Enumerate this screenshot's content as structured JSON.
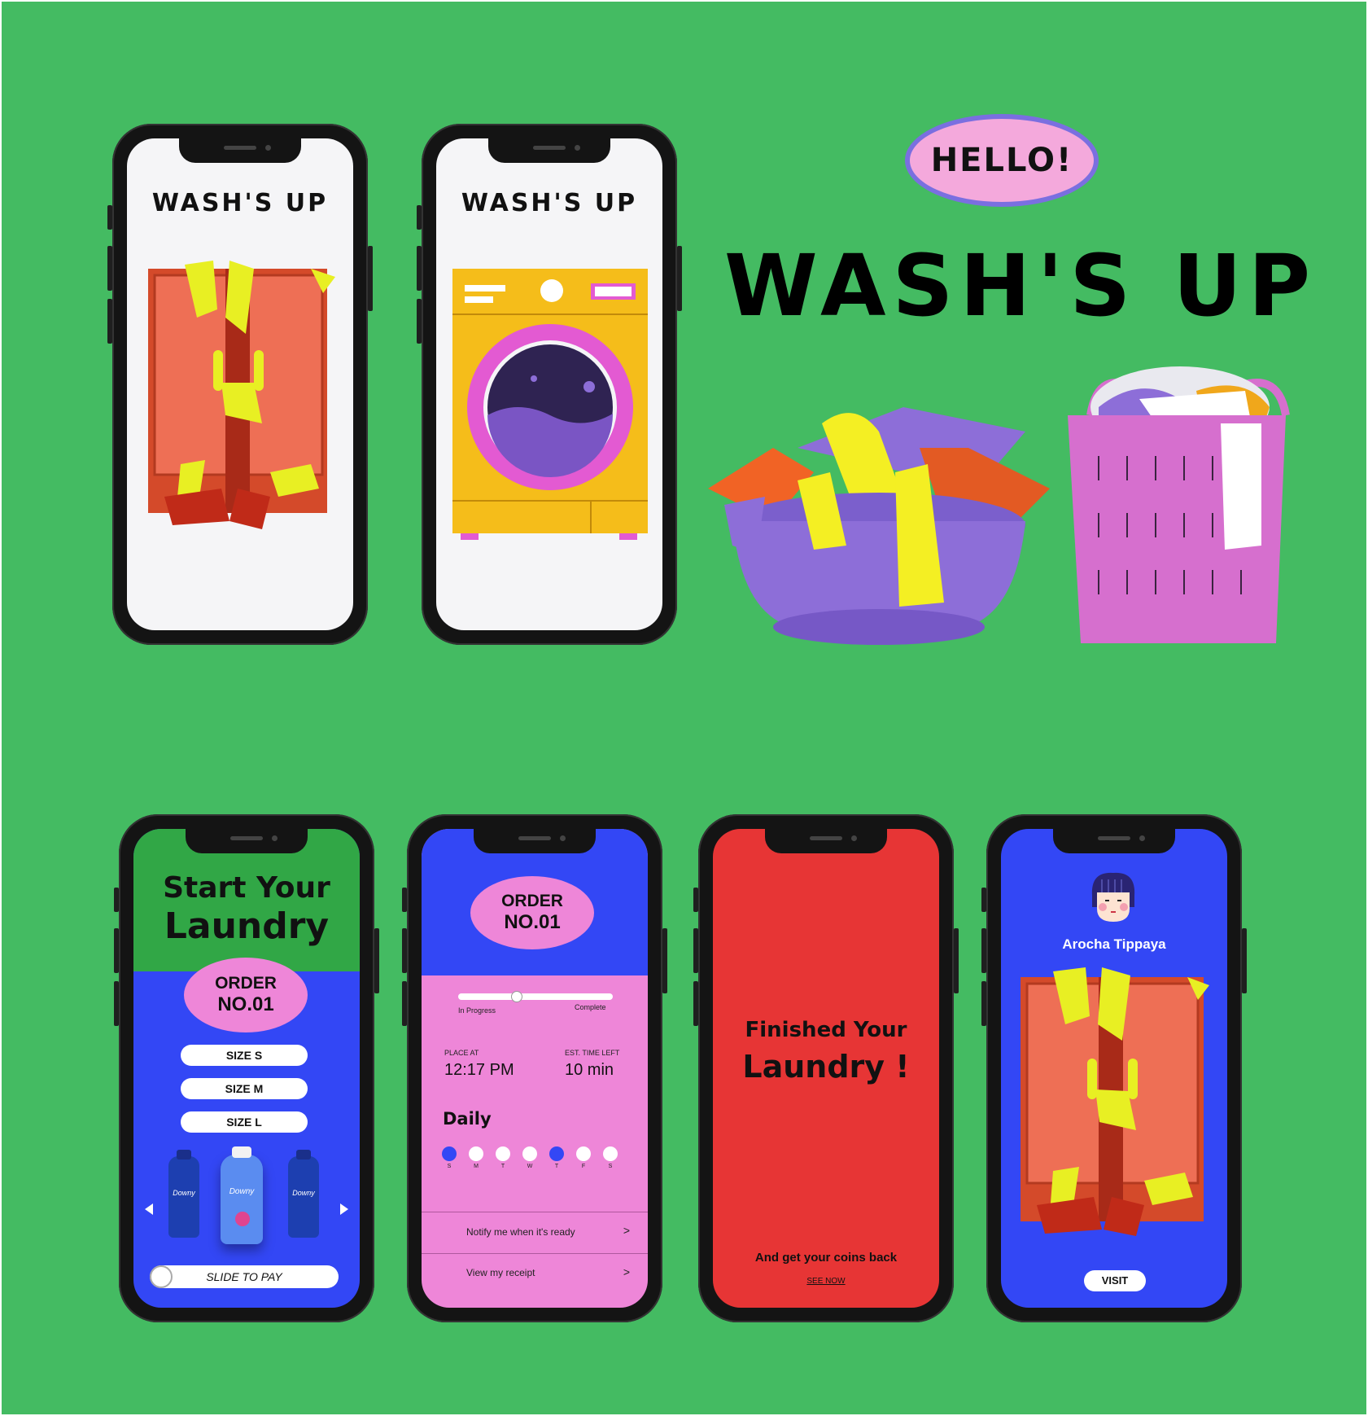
{
  "brand": {
    "hello": "HELLO!",
    "title": "WASH'S UP"
  },
  "colors": {
    "background": "#44bb62",
    "blue": "#3347f5",
    "pink": "#ee86d8",
    "red": "#e73535",
    "green": "#31a746"
  },
  "splash1": {
    "title": "WASH'S UP"
  },
  "splash2": {
    "title": "WASH'S UP"
  },
  "start": {
    "heading1": "Start Your",
    "heading2": "Laundry",
    "order1": "ORDER",
    "order2": "NO.01",
    "sizes": [
      "SIZE S",
      "SIZE M",
      "SIZE L"
    ],
    "products": [
      "Downy",
      "Downy",
      "Downy"
    ],
    "slide": "SLIDE TO PAY"
  },
  "order": {
    "order1": "ORDER",
    "order2": "NO.01",
    "progress_left": "In Progress",
    "progress_right": "Complete",
    "progress_fraction": 0.38,
    "place_label": "PLACE AT",
    "place_value": "12:17 PM",
    "est_label": "EST. TIME LEFT",
    "est_value": "10 min",
    "daily": "Daily",
    "days": [
      "S",
      "M",
      "T",
      "W",
      "T",
      "F",
      "S"
    ],
    "days_selected": [
      true,
      false,
      false,
      false,
      true,
      false,
      false
    ],
    "notify": "Notify me when it's ready",
    "receipt": "View my receipt"
  },
  "finished": {
    "line1": "Finished Your",
    "line2": "Laundry !",
    "coins": "And get your coins back",
    "see_now": "SEE NOW"
  },
  "profile": {
    "name": "Arocha Tippaya",
    "visit": "VISIT"
  }
}
